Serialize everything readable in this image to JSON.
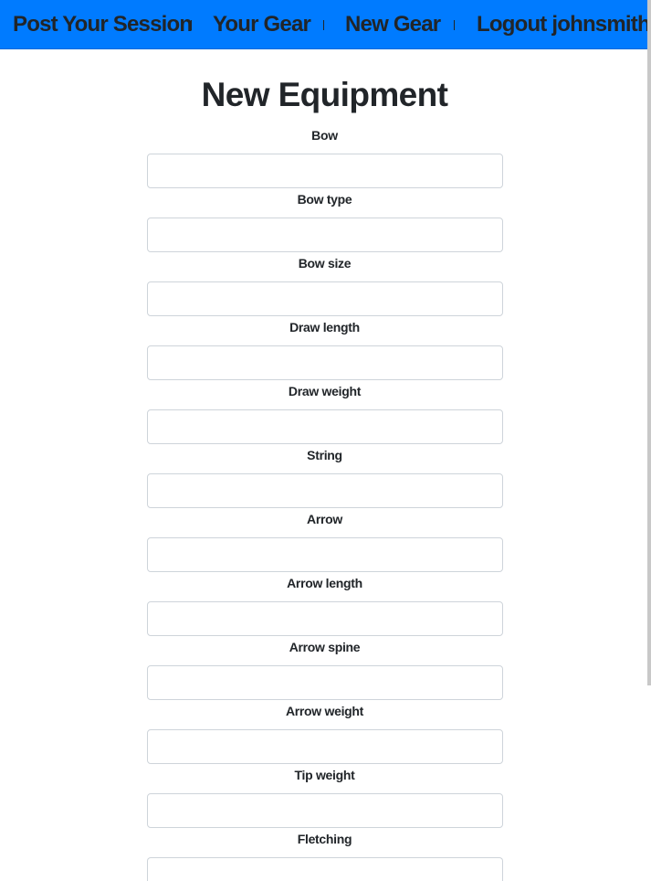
{
  "nav": {
    "post_session": "Post Your Session",
    "your_gear": "Your Gear",
    "new_gear": "New Gear",
    "logout": "Logout johnsmith",
    "separator": "|"
  },
  "page": {
    "title": "New Equipment"
  },
  "form": {
    "fields": [
      {
        "label": "Bow",
        "value": ""
      },
      {
        "label": "Bow type",
        "value": ""
      },
      {
        "label": "Bow size",
        "value": ""
      },
      {
        "label": "Draw length",
        "value": ""
      },
      {
        "label": "Draw weight",
        "value": ""
      },
      {
        "label": "String",
        "value": ""
      },
      {
        "label": "Arrow",
        "value": ""
      },
      {
        "label": "Arrow length",
        "value": ""
      },
      {
        "label": "Arrow spine",
        "value": ""
      },
      {
        "label": "Arrow weight",
        "value": ""
      },
      {
        "label": "Tip weight",
        "value": ""
      },
      {
        "label": "Fletching",
        "value": ""
      }
    ]
  },
  "colors": {
    "navbar": "#007bff",
    "text": "#212529",
    "input_border": "#ced4da"
  }
}
